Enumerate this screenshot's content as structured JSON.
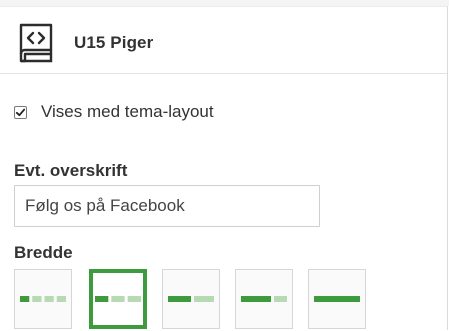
{
  "widget": {
    "title": "U15 Piger",
    "icon": "code-document-icon"
  },
  "theme_layout": {
    "checked": true,
    "label": "Vises med tema-layout"
  },
  "heading_field": {
    "label": "Evt. overskrift",
    "value": "Følg os på Facebook"
  },
  "width": {
    "label": "Bredde",
    "selected_index": 1,
    "options": [
      {
        "name": "width-option-1",
        "segments": [
          "#3d9a3d",
          "#b7d9b3",
          "#b7d9b3",
          "#b7d9b3"
        ]
      },
      {
        "name": "width-option-2",
        "segments": [
          "#3d9a3d",
          "#b7d9b3",
          "#b7d9b3"
        ]
      },
      {
        "name": "width-option-3",
        "segments": [
          "#3d9a3d",
          "#b7d9b3"
        ]
      },
      {
        "name": "width-option-4",
        "segments": [
          "#3d9a3d",
          "#b7d9b3"
        ]
      },
      {
        "name": "width-option-5",
        "segments": [
          "#3d9a3d"
        ]
      }
    ]
  },
  "colors": {
    "accent": "#3d9a3d",
    "accent_light": "#b7d9b3"
  }
}
